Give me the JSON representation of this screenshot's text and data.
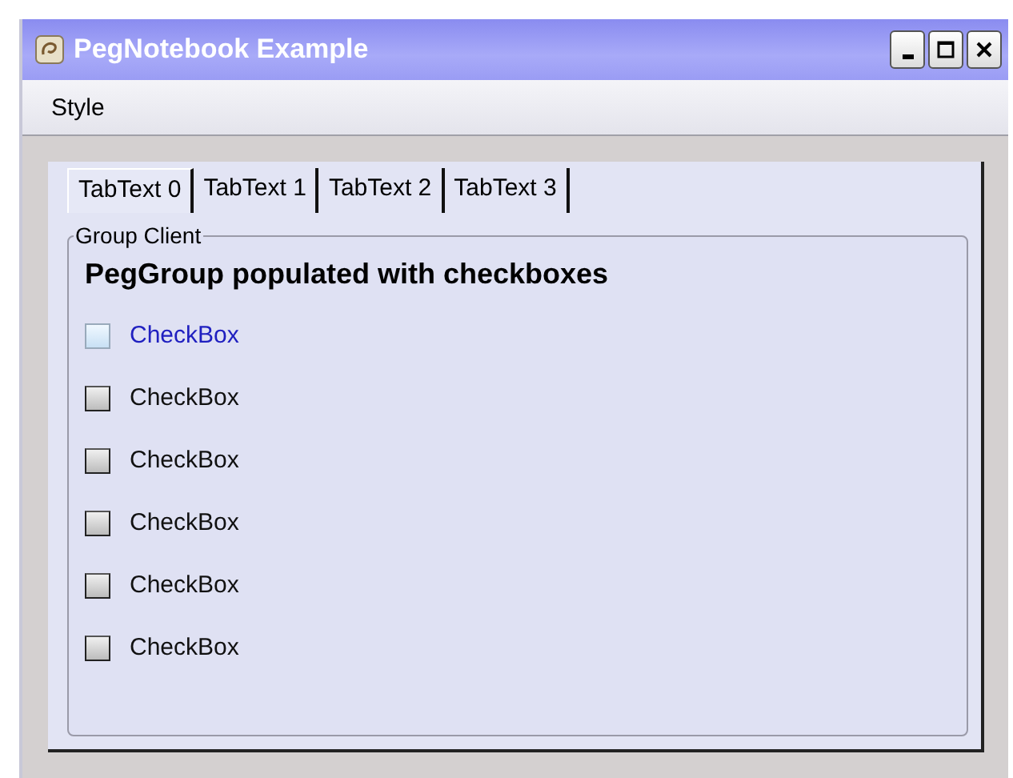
{
  "window": {
    "title": "PegNotebook Example"
  },
  "menu": [
    "Style"
  ],
  "tabs": [
    {
      "label": "TabText 0",
      "selected": true
    },
    {
      "label": "TabText 1",
      "selected": false
    },
    {
      "label": "TabText 2",
      "selected": false
    },
    {
      "label": "TabText 3",
      "selected": false
    }
  ],
  "group": {
    "title": "Group Client",
    "heading": "PegGroup populated with checkboxes",
    "checkboxes": [
      {
        "label": "CheckBox",
        "checked": false,
        "focused": true
      },
      {
        "label": "CheckBox",
        "checked": false,
        "focused": false
      },
      {
        "label": "CheckBox",
        "checked": false,
        "focused": false
      },
      {
        "label": "CheckBox",
        "checked": false,
        "focused": false
      },
      {
        "label": "CheckBox",
        "checked": false,
        "focused": false
      },
      {
        "label": "CheckBox",
        "checked": false,
        "focused": false
      }
    ]
  }
}
